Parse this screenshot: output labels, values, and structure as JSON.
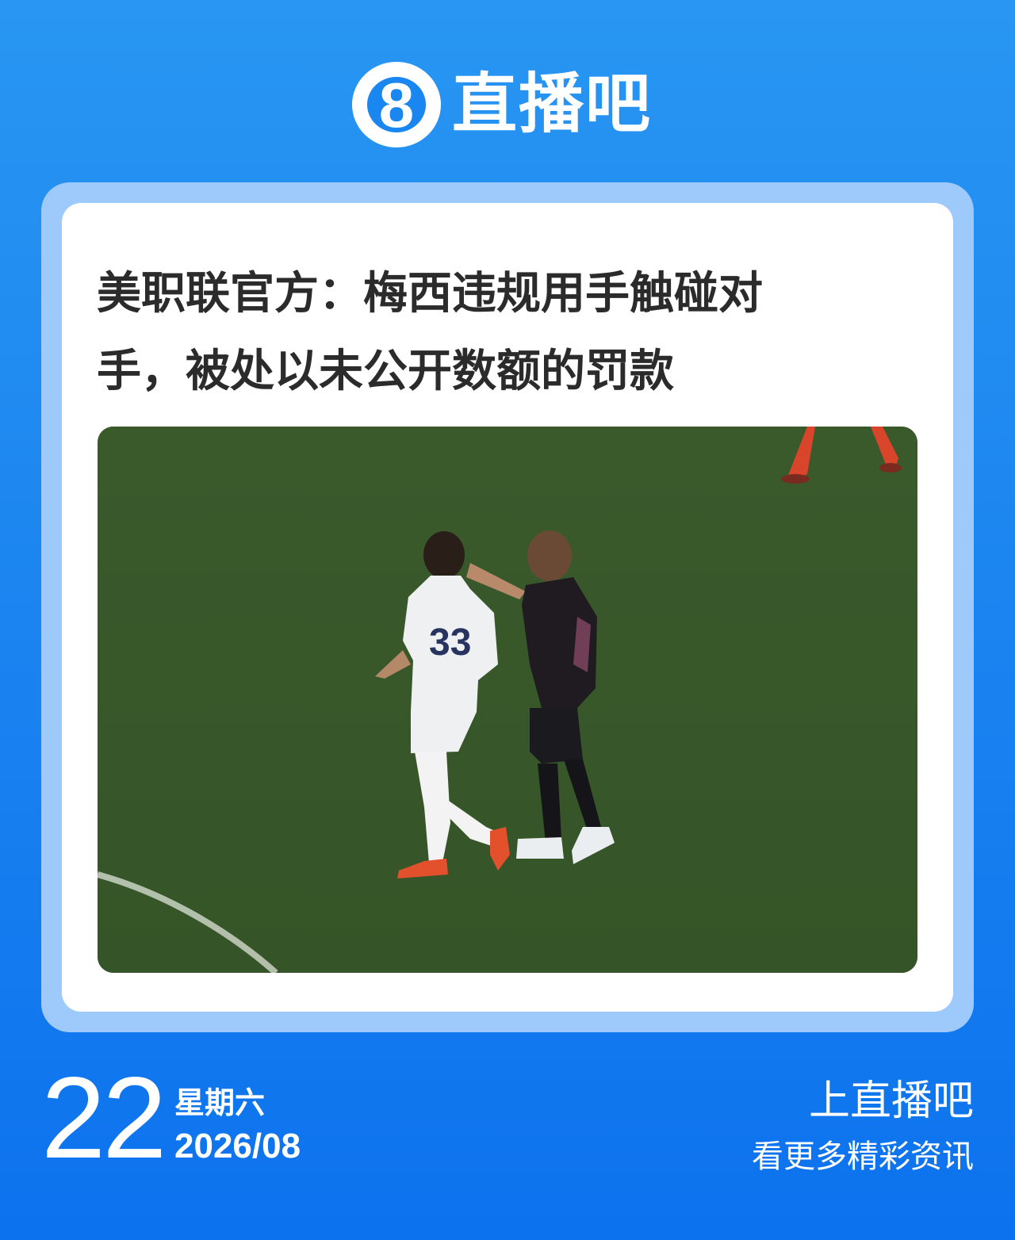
{
  "header": {
    "logo_icon": "circle-eight-logo-icon",
    "logo_text": "8",
    "brand_name": "直播吧"
  },
  "article": {
    "headline": "美职联官方：梅西违规用手触碰对手，被处以未公开数额的罚款",
    "photo_icon": "soccer-match-photo"
  },
  "footer": {
    "day": "22",
    "weekday": "星期六",
    "year_month": "2026/08",
    "cta": "上直播吧",
    "sub": "看更多精彩资讯"
  },
  "colors": {
    "background": "#1b84f0",
    "card_border": "#9dc9fb",
    "card": "#ffffff",
    "headline": "#2b2b2b"
  }
}
